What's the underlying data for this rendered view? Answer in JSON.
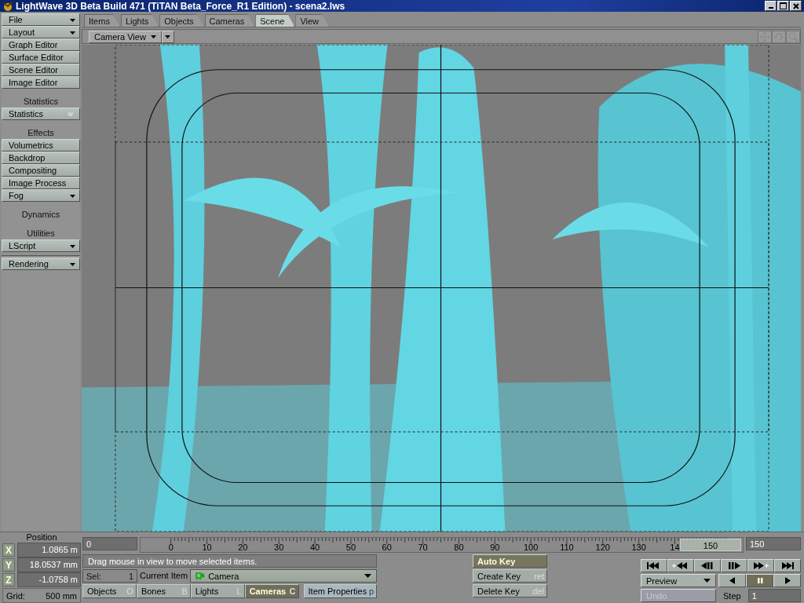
{
  "window": {
    "title": "LightWave 3D Beta Build 471  (TiTAN  Beta_Force_R1 Edition) - scena2.lws",
    "controls": [
      {
        "kind": "minimize"
      },
      {
        "kind": "maximize"
      },
      {
        "kind": "close"
      }
    ]
  },
  "sidebar": {
    "items": [
      {
        "kind": "dropdown",
        "label": "File"
      },
      {
        "kind": "dropdown",
        "label": "Layout"
      },
      {
        "kind": "button",
        "label": "Graph Editor"
      },
      {
        "kind": "button",
        "label": "Surface Editor"
      },
      {
        "kind": "button",
        "label": "Scene Editor"
      },
      {
        "kind": "button",
        "label": "Image Editor"
      },
      {
        "kind": "heading",
        "label": "Statistics"
      },
      {
        "kind": "button",
        "label": "Statistics",
        "key": "w"
      },
      {
        "kind": "heading",
        "label": "Effects"
      },
      {
        "kind": "button",
        "label": "Volumetrics"
      },
      {
        "kind": "button",
        "label": "Backdrop"
      },
      {
        "kind": "button",
        "label": "Compositing"
      },
      {
        "kind": "button",
        "label": "Image Process"
      },
      {
        "kind": "dropdown",
        "label": "Fog"
      },
      {
        "kind": "heading",
        "label": "Dynamics"
      },
      {
        "kind": "heading",
        "label": "Utilities"
      },
      {
        "kind": "dropdown",
        "label": "LScript"
      },
      {
        "kind": "separator"
      },
      {
        "kind": "dropdown",
        "label": "Rendering"
      }
    ]
  },
  "tabs": [
    {
      "label": "Items",
      "selected": false
    },
    {
      "label": "Lights",
      "selected": false
    },
    {
      "label": "Objects",
      "selected": false
    },
    {
      "label": "Cameras",
      "selected": false
    },
    {
      "label": "Scene",
      "selected": true
    },
    {
      "label": "View",
      "selected": false
    }
  ],
  "viewport": {
    "view_menu": "Camera View",
    "tools": [
      {
        "kind": "move"
      },
      {
        "kind": "rotate"
      },
      {
        "kind": "zoom"
      }
    ]
  },
  "position": {
    "label": "Position",
    "axes": [
      {
        "axis": "X",
        "value": "1.0865 m"
      },
      {
        "axis": "Y",
        "value": "18.0537 mm"
      },
      {
        "axis": "Z",
        "value": "-1.0758 m"
      }
    ],
    "grid": {
      "label": "Grid:",
      "value": "500 mm"
    }
  },
  "timeline": {
    "start": "0",
    "end": "150",
    "thumb": "150",
    "level": 1,
    "ticks": [
      "0",
      "10",
      "20",
      "30",
      "40",
      "50",
      "60",
      "70",
      "80",
      "90",
      "100",
      "110",
      "120",
      "130",
      "14"
    ]
  },
  "status": "Drag mouse in view to move selected items.",
  "selection": {
    "label": "Sel:",
    "value": "1"
  },
  "current_item": {
    "label": "Current Item",
    "value": "Camera"
  },
  "item_types": [
    {
      "label": "Objects",
      "key": "O",
      "selected": false
    },
    {
      "label": "Bones",
      "key": "B",
      "selected": false
    },
    {
      "label": "Lights",
      "key": "L",
      "selected": false
    },
    {
      "label": "Cameras",
      "key": "C",
      "selected": true
    }
  ],
  "item_properties": {
    "label": "Item Properties",
    "key": "p"
  },
  "keys": [
    {
      "label": "Auto Key",
      "selected": true
    },
    {
      "label": "Create Key",
      "key": "ret",
      "selected": false
    },
    {
      "label": "Delete Key",
      "key": "del",
      "selected": false
    }
  ],
  "transport": [
    {
      "kind": "first"
    },
    {
      "kind": "prev-key"
    },
    {
      "kind": "prev-frame"
    },
    {
      "kind": "next-frame"
    },
    {
      "kind": "next-key"
    },
    {
      "kind": "last"
    }
  ],
  "preview": "Preview",
  "playback": [
    {
      "kind": "reverse",
      "selected": false
    },
    {
      "kind": "pause",
      "selected": true
    },
    {
      "kind": "play",
      "selected": false
    }
  ],
  "undo": {
    "label": "Undo",
    "disabled": true
  },
  "step": {
    "label": "Step",
    "value": "1"
  }
}
